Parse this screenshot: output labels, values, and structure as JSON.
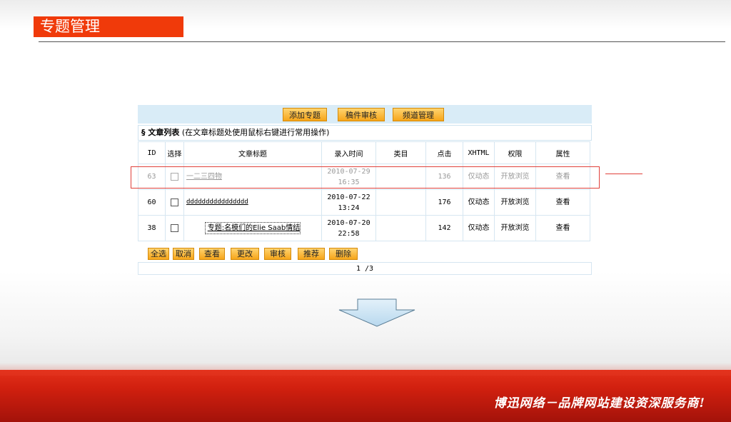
{
  "slide": {
    "title": "专题管理",
    "slogan": "博迅网络－品牌网站建设资深服务商!"
  },
  "toolbar": {
    "buttons": [
      "添加专题",
      "稿件审核",
      "频道管理"
    ]
  },
  "section": {
    "label": "§ 文章列表",
    "hint": "(在文章标题处使用鼠标右键进行常用操作)"
  },
  "table": {
    "headers": [
      "ID",
      "选择",
      "文章标题",
      "录入时间",
      "类目",
      "点击",
      "XHTML",
      "权限",
      "属性"
    ],
    "rows": [
      {
        "id": "63",
        "title": "一二三四物",
        "time": "2010-07-29 16:35",
        "category": "",
        "clicks": "136",
        "xhtml": "仅动态",
        "permission": "开放浏览",
        "attr": "查看"
      },
      {
        "id": "60",
        "title": "dddddddddddddddd",
        "time": "2010-07-22 13:24",
        "category": "",
        "clicks": "176",
        "xhtml": "仅动态",
        "permission": "开放浏览",
        "attr": "查看"
      },
      {
        "id": "38",
        "title": "专题:名模们的Elie Saab情结",
        "time": "2010-07-20 22:58",
        "category": "",
        "clicks": "142",
        "xhtml": "仅动态",
        "permission": "开放浏览",
        "attr": "查看"
      }
    ]
  },
  "actions": [
    "全选",
    "取消",
    "查看",
    "更改",
    "审核",
    "推荐",
    "删除"
  ],
  "pager": "1 /3",
  "colors": {
    "title_bg": "#f03a0a",
    "button_orange": "#f6a51a",
    "toolbar_blue": "#d9ecf7",
    "highlight_red": "#e0403a",
    "footer_red": "#d1200f"
  }
}
